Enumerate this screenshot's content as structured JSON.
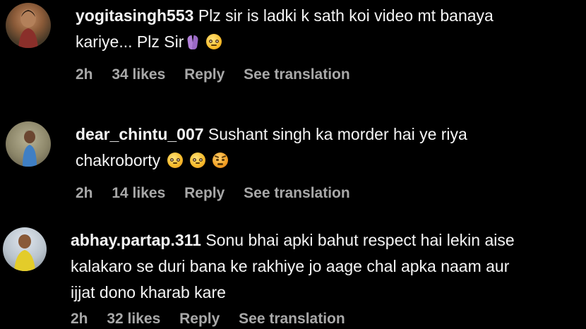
{
  "comments": [
    {
      "username": "yogitasingh553",
      "text_line1": "Plz sir is ladki k sath koi video mt banaya",
      "text_line2": "kariye... Plz Sir",
      "time": "2h",
      "likes": "34 likes",
      "reply_label": "Reply",
      "translation_label": "See translation",
      "avatar_color": "#7a5a3a"
    },
    {
      "username": "dear_chintu_007",
      "text_line1": "Sushant singh ka morder hai ye riya",
      "text_line2": "chakroborty",
      "time": "2h",
      "likes": "14 likes",
      "reply_label": "Reply",
      "translation_label": "See translation",
      "avatar_color": "#8f8a6c"
    },
    {
      "username": "abhay.partap.311",
      "text_line1": "Sonu bhai apki bahut respect hai lekin aise",
      "text_line2": "kalakaro se duri bana ke rakhiye jo aage chal apka naam aur",
      "text_line3": "ijjat dono kharab kare",
      "time": "2h",
      "likes": "32 likes",
      "reply_label": "Reply",
      "translation_label": "See translation",
      "avatar_color": "#c9b23a"
    }
  ],
  "icons": {
    "emoji_pleading": "pleading-face-emoji",
    "emoji_praying": "folded-hands-emoji",
    "emoji_flushed": "flushed-face-emoji",
    "emoji_angry": "angry-face-emoji"
  },
  "colors": {
    "background": "#000000",
    "text": "#f5f5f5",
    "meta": "#a8a8a8"
  }
}
